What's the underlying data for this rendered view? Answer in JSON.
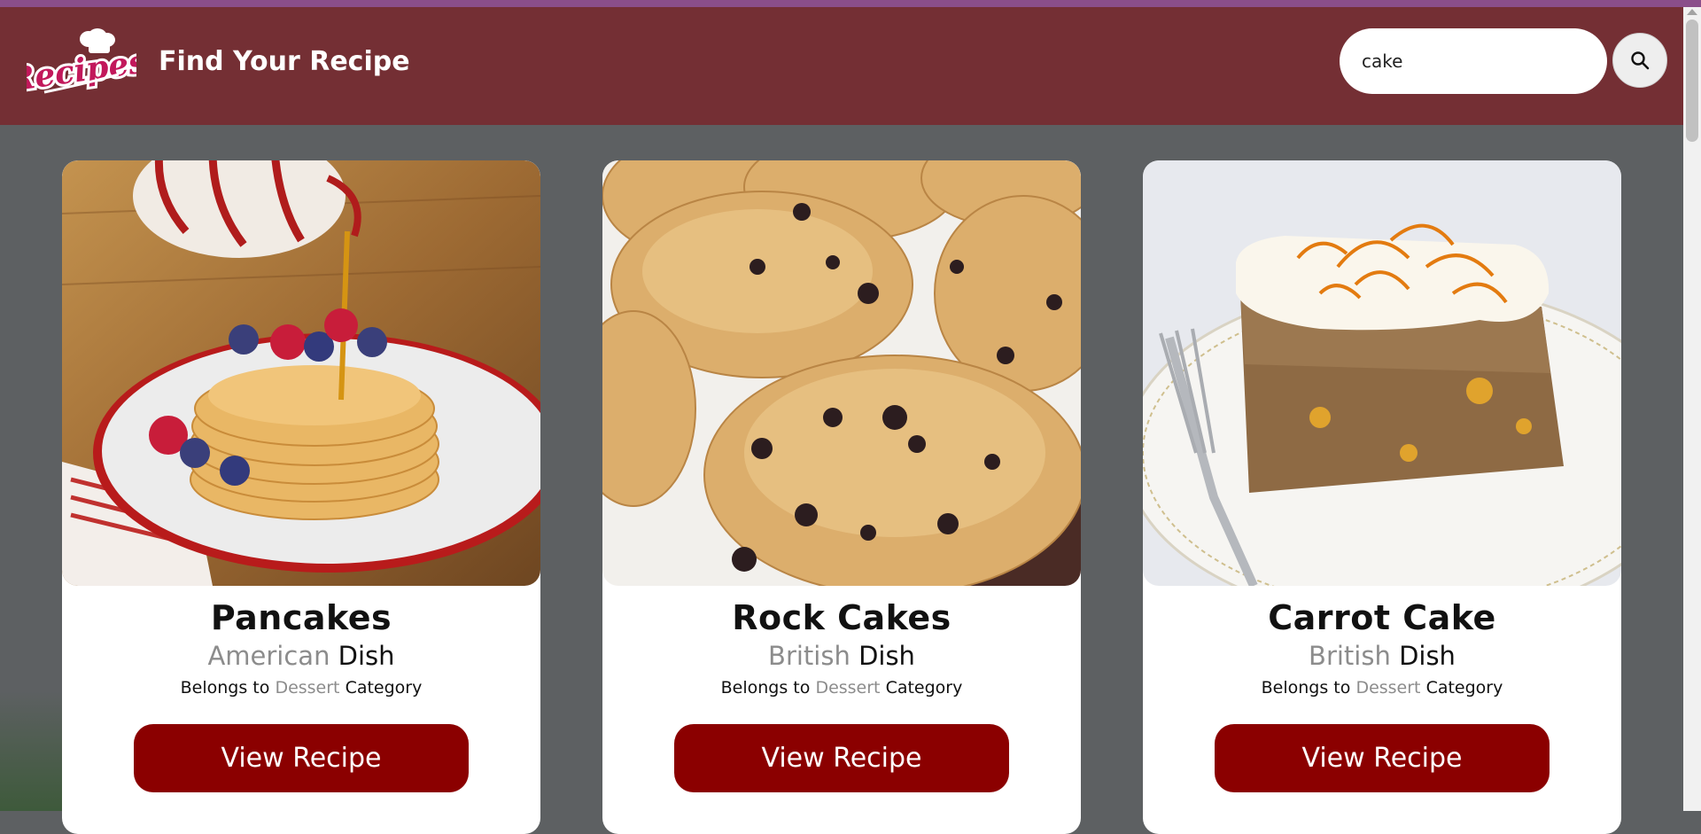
{
  "header": {
    "logo_text": "Recipes",
    "title": "Find Your Recipe"
  },
  "search": {
    "value": "cake",
    "icon": "search-icon"
  },
  "colors": {
    "header_bg": "#742f34",
    "page_bg": "#5d6062",
    "button_bg": "#8b0000",
    "muted_text": "#8c8c8c"
  },
  "cards": [
    {
      "title": "Pancakes",
      "cuisine": "American",
      "dish_word": "Dish",
      "belongs_prefix": "Belongs to",
      "category": "Dessert",
      "category_suffix": "Category",
      "button_label": "View Recipe"
    },
    {
      "title": "Rock Cakes",
      "cuisine": "British",
      "dish_word": "Dish",
      "belongs_prefix": "Belongs to",
      "category": "Dessert",
      "category_suffix": "Category",
      "button_label": "View Recipe"
    },
    {
      "title": "Carrot Cake",
      "cuisine": "British",
      "dish_word": "Dish",
      "belongs_prefix": "Belongs to",
      "category": "Dessert",
      "category_suffix": "Category",
      "button_label": "View Recipe"
    }
  ]
}
